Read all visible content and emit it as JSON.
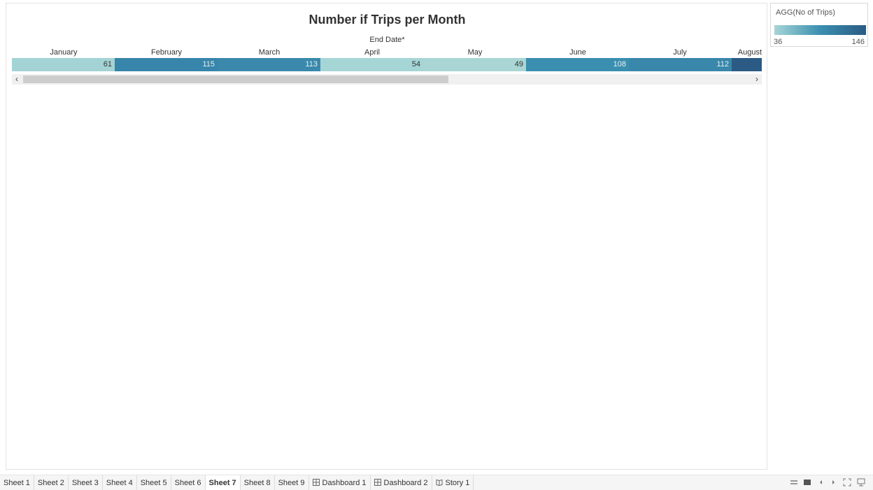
{
  "chart_data": {
    "type": "heatmap",
    "title": "Number if Trips per Month",
    "xlabel": "End Date*",
    "categories": [
      "January",
      "February",
      "March",
      "April",
      "May",
      "June",
      "July",
      "August"
    ],
    "values": [
      61,
      115,
      113,
      54,
      49,
      108,
      112,
      null
    ],
    "value_labels": [
      "61",
      "115",
      "113",
      "54",
      "49",
      "108",
      "112",
      ""
    ],
    "colors": [
      "#a3d3d5",
      "#3785aa",
      "#3a89ac",
      "#a6d5d6",
      "#a9d6d5",
      "#3a8fb0",
      "#3987ab",
      "#2b5b84"
    ]
  },
  "legend": {
    "title": "AGG(No of Trips)",
    "min_label": "36",
    "max_label": "146",
    "ramp_colors": [
      "#a6d5d7",
      "#2b5b84"
    ]
  },
  "scrollbar": {
    "left_arrow": "‹",
    "right_arrow": "›"
  },
  "tabs": [
    {
      "label": "Sheet 1",
      "active": false,
      "icon": ""
    },
    {
      "label": "Sheet 2",
      "active": false,
      "icon": ""
    },
    {
      "label": "Sheet 3",
      "active": false,
      "icon": ""
    },
    {
      "label": "Sheet 4",
      "active": false,
      "icon": ""
    },
    {
      "label": "Sheet 5",
      "active": false,
      "icon": ""
    },
    {
      "label": "Sheet 6",
      "active": false,
      "icon": ""
    },
    {
      "label": "Sheet 7",
      "active": true,
      "icon": ""
    },
    {
      "label": "Sheet 8",
      "active": false,
      "icon": ""
    },
    {
      "label": "Sheet 9",
      "active": false,
      "icon": ""
    },
    {
      "label": "Dashboard 1",
      "active": false,
      "icon": "dashboard-icon"
    },
    {
      "label": "Dashboard 2",
      "active": false,
      "icon": "dashboard-icon"
    },
    {
      "label": "Story 1",
      "active": false,
      "icon": "story-icon"
    }
  ],
  "controls": [
    "show-filmstrip-icon",
    "show-tabs-icon",
    "previous-sheet-icon",
    "next-sheet-icon",
    "presentation-mode-icon",
    "present-icon"
  ]
}
